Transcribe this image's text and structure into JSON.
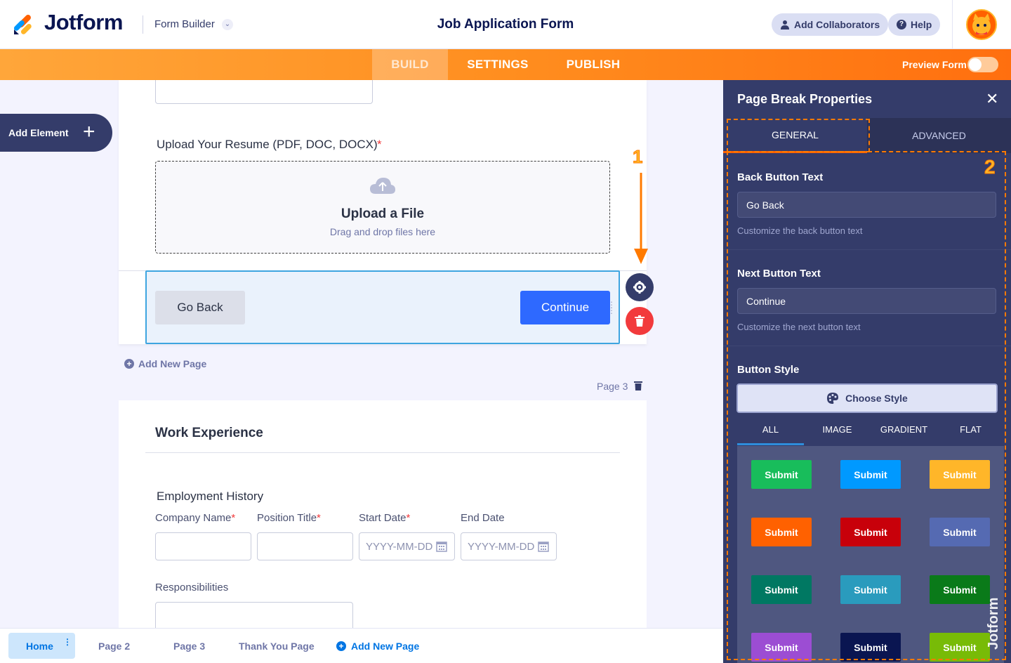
{
  "header": {
    "brand": "Jotform",
    "builder_label": "Form Builder",
    "form_title": "Job Application Form",
    "add_collaborators": "Add Collaborators",
    "help": "Help"
  },
  "nav": {
    "tabs": [
      "BUILD",
      "SETTINGS",
      "PUBLISH"
    ],
    "active": "BUILD",
    "preview_label": "Preview Form",
    "preview_enabled": false
  },
  "sidebar": {
    "add_element": "Add Element"
  },
  "canvas": {
    "upload_field": {
      "label": "Upload Your Resume (PDF, DOC, DOCX)",
      "required_mark": "*",
      "title": "Upload a File",
      "subtitle": "Drag and drop files here"
    },
    "page_break": {
      "back_label": "Go Back",
      "next_label": "Continue"
    },
    "add_new_page": "Add New Page",
    "page_label": "Page 3",
    "work_section": {
      "title": "Work Experience",
      "subheading": "Employment History",
      "columns": [
        {
          "label": "Company Name",
          "required": "*",
          "placeholder": ""
        },
        {
          "label": "Position Title",
          "required": "*",
          "placeholder": ""
        },
        {
          "label": "Start Date",
          "required": "*",
          "placeholder": "YYYY-MM-DD"
        },
        {
          "label": "End Date",
          "required": "",
          "placeholder": "YYYY-MM-DD"
        }
      ],
      "responsibilities": "Responsibilities"
    }
  },
  "annotations": {
    "one": "1",
    "two": "2"
  },
  "bottom_bar": {
    "pages": [
      "Home",
      "Page 2",
      "Page 3",
      "Thank You Page"
    ],
    "active": "Home",
    "add_page": "Add New Page"
  },
  "panel": {
    "title": "Page Break Properties",
    "tabs": [
      "GENERAL",
      "ADVANCED"
    ],
    "active_tab": "GENERAL",
    "back_button": {
      "label": "Back Button Text",
      "value": "Go Back",
      "hint": "Customize the back button text"
    },
    "next_button": {
      "label": "Next Button Text",
      "value": "Continue",
      "hint": "Customize the next button text"
    },
    "button_style": {
      "label": "Button Style",
      "choose": "Choose Style",
      "filters": [
        "ALL",
        "IMAGE",
        "GRADIENT",
        "FLAT"
      ],
      "active_filter": "ALL",
      "swatches": [
        {
          "label": "Submit",
          "color": "#18bd5b"
        },
        {
          "label": "Submit",
          "color": "#0099ff"
        },
        {
          "label": "Submit",
          "color": "#ffb629"
        },
        {
          "label": "Submit",
          "color": "#ff6100"
        },
        {
          "label": "Submit",
          "color": "#c8000a"
        },
        {
          "label": "Submit",
          "color": "#556ab2"
        },
        {
          "label": "Submit",
          "color": "#007862"
        },
        {
          "label": "Submit",
          "color": "#2a9bbd"
        },
        {
          "label": "Submit",
          "color": "#0a7a19"
        },
        {
          "label": "Submit",
          "color": "#9c4dd3"
        },
        {
          "label": "Submit",
          "color": "#0a1551"
        },
        {
          "label": "Submit",
          "color": "#78bb07"
        }
      ]
    },
    "watermark": "Jotform"
  },
  "colors": {
    "accent": "#ff6100",
    "primary": "#2e69ff",
    "panel": "#343c6a"
  }
}
